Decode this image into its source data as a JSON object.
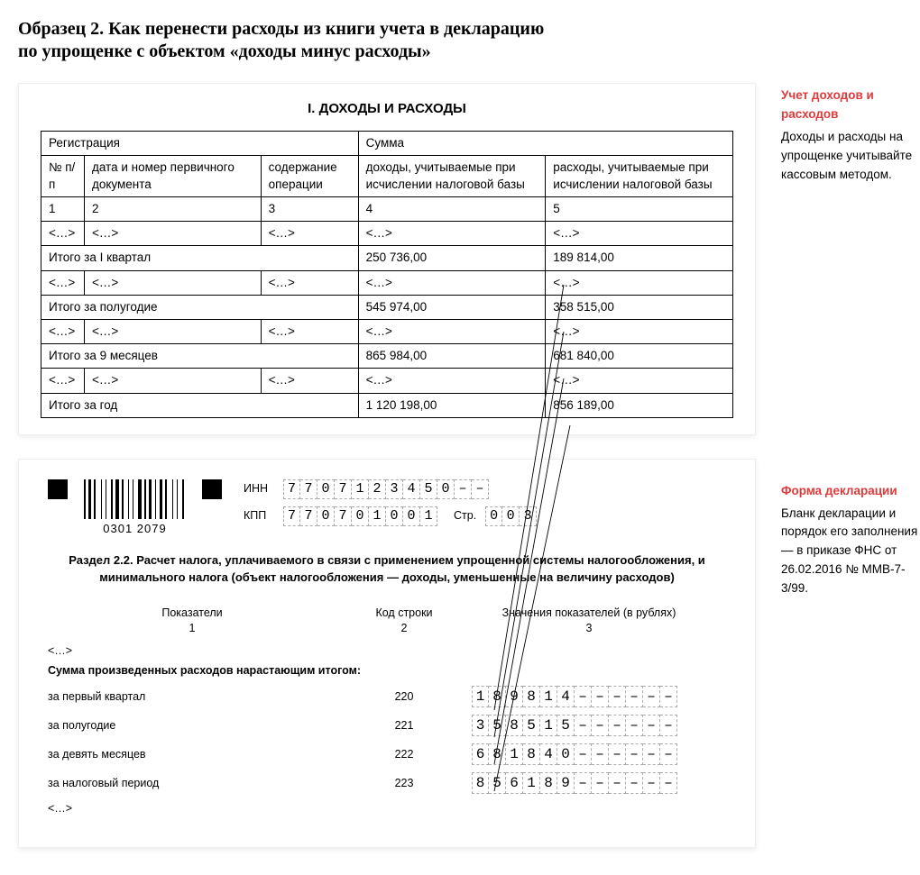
{
  "title_line1": "Образец 2. Как перенести расходы из книги учета в декларацию",
  "title_line2": "по упрощенке с объектом «доходы минус расходы»",
  "panel1": {
    "heading": "I. ДОХОДЫ И РАСХОДЫ",
    "hdr_reg": "Регистрация",
    "hdr_sum": "Сумма",
    "col1": "№ п/п",
    "col2": "дата и номер первичного документа",
    "col3": "содержание операции",
    "col4": "доходы, учитываемые при исчислении налоговой базы",
    "col5": "расходы, учитываемые при исчислении налоговой базы",
    "n1": "1",
    "n2": "2",
    "n3": "3",
    "n4": "4",
    "n5": "5",
    "ell": "<…>",
    "itog_q1": "Итого за I квартал",
    "q1_d": "250 736,00",
    "q1_r": "189 814,00",
    "itog_h1": "Итого за полугодие",
    "h1_d": "545 974,00",
    "h1_r": "358 515,00",
    "itog_9m": "Итого за 9 месяцев",
    "m9_d": "865 984,00",
    "m9_r": "681 840,00",
    "itog_y": "Итого за год",
    "y_d": "1 120 198,00",
    "y_r": "856 189,00"
  },
  "panel2": {
    "barcode_num": "0301 2079",
    "inn_label": "ИНН",
    "kpp_label": "КПП",
    "inn": "7707123450––",
    "kpp": "770701001",
    "str_label": "Стр.",
    "str_val": "003",
    "section_title": "Раздел 2.2. Расчет налога, уплачиваемого в связи с применением упрощенной системы налогообложения, и минимального налога (объект налогообложения — доходы, уменьшенные на величину расходов)",
    "head_pokaz": "Показатели",
    "head_code": "Код строки",
    "head_val": "Значения показателей (в рублях)",
    "sub1": "1",
    "sub2": "2",
    "sub3": "3",
    "ell": "<…>",
    "sum_line": "Сумма произведенных расходов нарастающим итогом:",
    "rows": [
      {
        "label": "за первый квартал",
        "code": "220",
        "val": "189814––––––"
      },
      {
        "label": "за полугодие",
        "code": "221",
        "val": "358515––––––"
      },
      {
        "label": "за девять месяцев",
        "code": "222",
        "val": "681840––––––"
      },
      {
        "label": "за налоговый период",
        "code": "223",
        "val": "856189––––––"
      }
    ]
  },
  "side1_head": "Учет доходов и расходов",
  "side1_body": "Доходы и расходы на упрощенке учитывайте кассовым методом.",
  "side2_head": "Форма декларации",
  "side2_body": "Бланк декларации и порядок его заполнения — в приказе ФНС от 26.02.2016 № ММВ-7-3/99."
}
